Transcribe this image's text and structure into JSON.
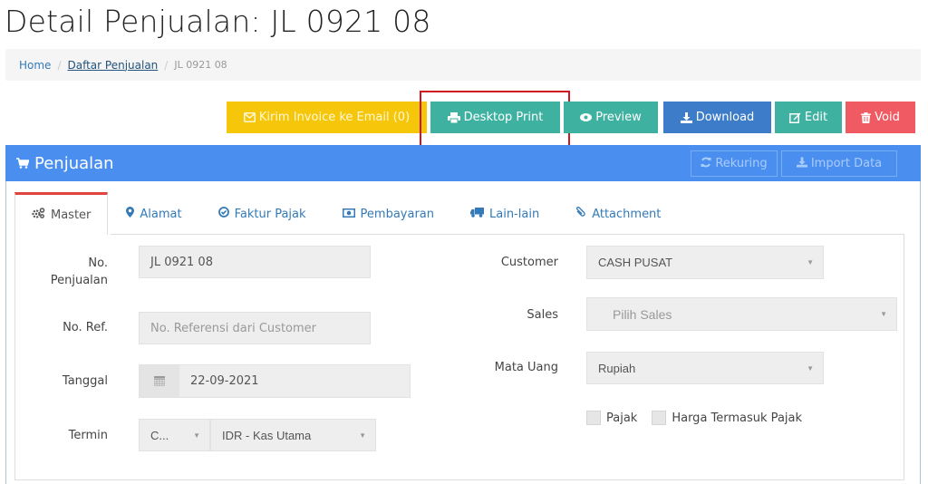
{
  "page": {
    "title": "Detail Penjualan: JL 0921 08"
  },
  "breadcrumb": {
    "home": "Home",
    "list": "Daftar Penjualan",
    "current": "JL 0921 08",
    "separator": "/"
  },
  "toolbar": {
    "email_label": "Kirim Invoice ke Email (0)",
    "print_label": "Desktop Print",
    "preview_label": "Preview",
    "download_label": "Download",
    "edit_label": "Edit",
    "void_label": "Void"
  },
  "panel": {
    "title": "Penjualan",
    "rekuring_label": "Rekuring",
    "import_label": "Import Data"
  },
  "tabs": [
    {
      "label": "Master",
      "icon": "gears-icon",
      "active": true
    },
    {
      "label": "Alamat",
      "icon": "map-marker-icon",
      "active": false
    },
    {
      "label": "Faktur Pajak",
      "icon": "check-circle-icon",
      "active": false
    },
    {
      "label": "Pembayaran",
      "icon": "money-icon",
      "active": false
    },
    {
      "label": "Lain-lain",
      "icon": "truck-icon",
      "active": false
    },
    {
      "label": "Attachment",
      "icon": "paperclip-icon",
      "active": false
    }
  ],
  "form": {
    "no_penjualan": {
      "label_line1": "No.",
      "label_line2": "Penjualan",
      "value": "JL 0921 08"
    },
    "no_ref": {
      "label": "No. Ref.",
      "placeholder": "No. Referensi dari Customer"
    },
    "tanggal": {
      "label": "Tanggal",
      "value": "22-09-2021"
    },
    "termin": {
      "label": "Termin",
      "value": "C...",
      "account": "IDR - Kas Utama"
    },
    "customer": {
      "label": "Customer",
      "value": "CASH PUSAT"
    },
    "sales": {
      "label": "Sales",
      "placeholder": "Pilih Sales"
    },
    "mata_uang": {
      "label": "Mata Uang",
      "value": "Rupiah"
    },
    "pajak": {
      "label": "Pajak",
      "checked": false
    },
    "harga_termasuk_pajak": {
      "label": "Harga Termasuk Pajak",
      "checked": false
    }
  },
  "colors": {
    "email": "#f5c60a",
    "teal": "#3fb1a1",
    "download": "#3d7cc9",
    "void": "#ef5a63",
    "panel_header": "#4a8ff0",
    "highlight": "#d0161f",
    "active_tab": "#e0443f"
  }
}
